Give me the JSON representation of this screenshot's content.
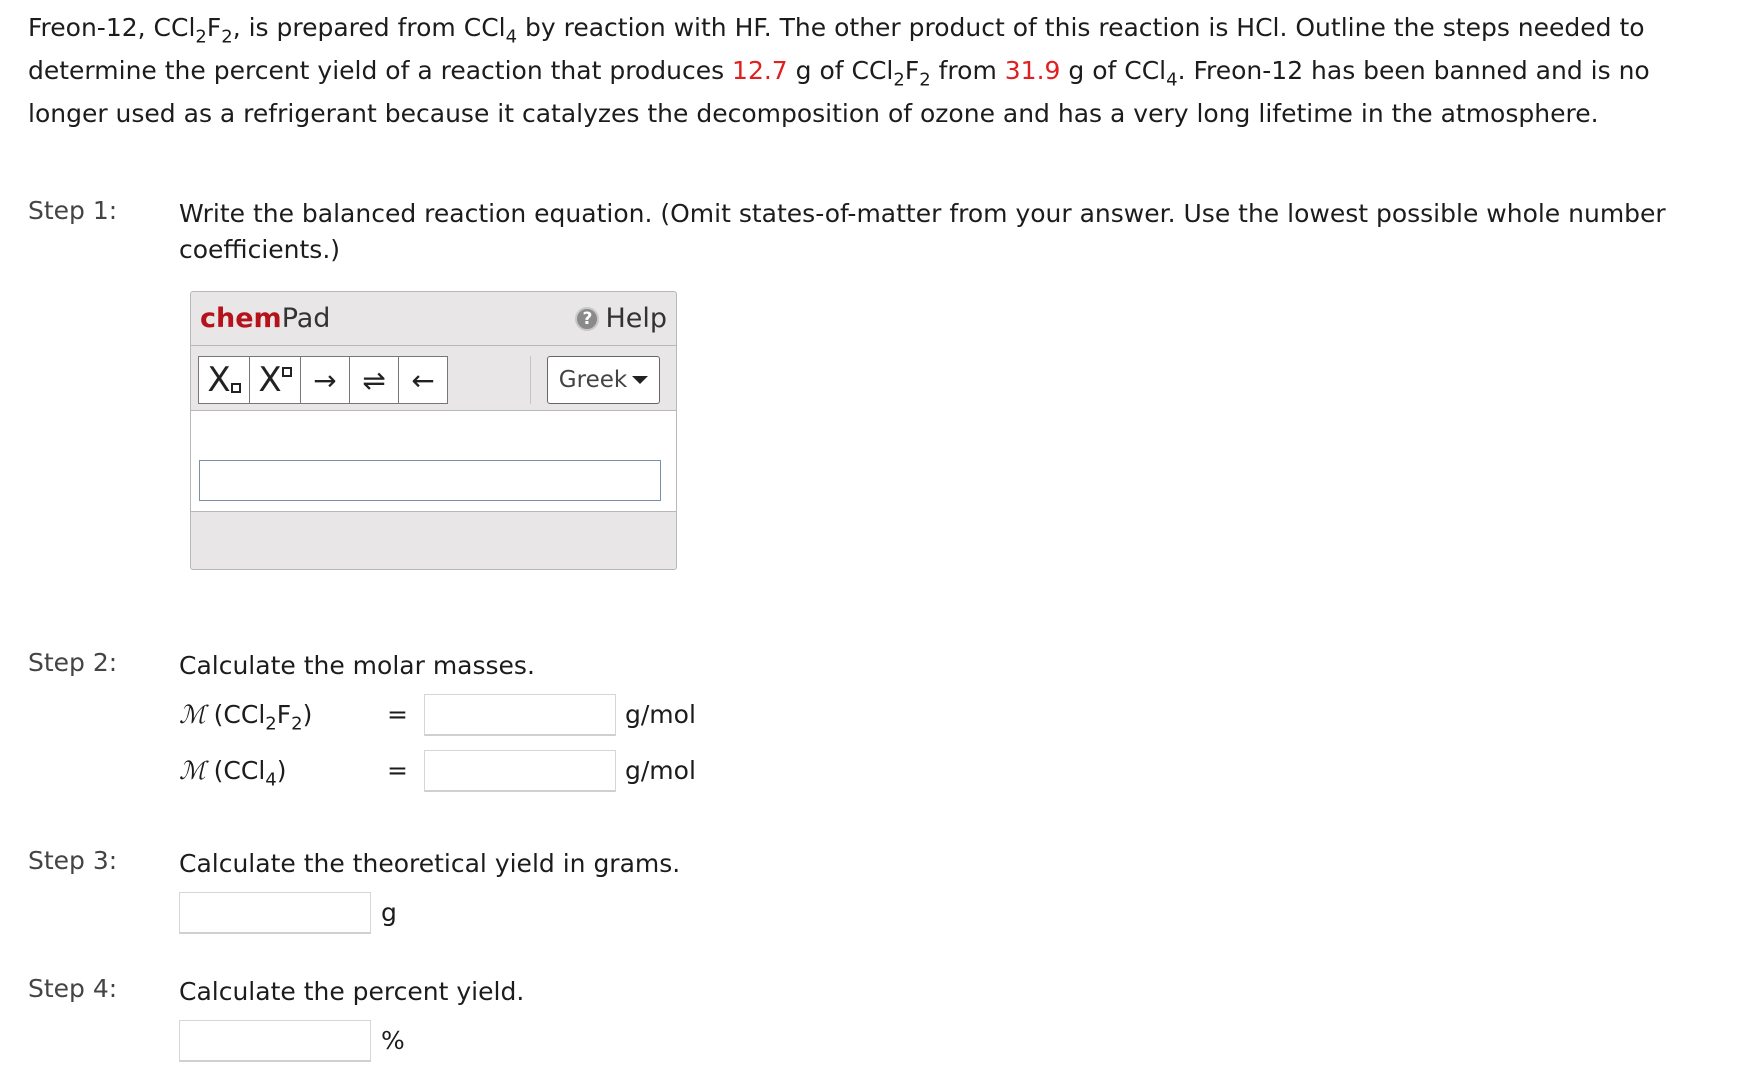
{
  "intro": {
    "p1": "Freon-12, CCl",
    "p1_sub1": "2",
    "p1_f": "F",
    "p1_sub2": "2",
    "p1_rest": ", is prepared from CCl",
    "p1_sub3": "4",
    "p1_rest2": " by reaction with HF. The other product of this reaction is HCl. Outline the steps needed to determine the percent yield of a reaction that produces ",
    "mass_product": "12.7",
    "p2": " g of CCl",
    "p2_sub1": "2",
    "p2_f": "F",
    "p2_sub2": "2",
    "p2_rest": " from ",
    "mass_reactant": "31.9",
    "p3": " g of CCl",
    "p3_sub": "4",
    "p3_rest": ". Freon-12 has been banned and is no longer used as a refrigerant because it catalyzes the decomposition of ozone and has a very long lifetime in the atmosphere."
  },
  "step1": {
    "label": "Step 1:",
    "text": "Write the balanced reaction equation. (Omit states-of-matter from your answer. Use the lowest possible whole number coefficients.)"
  },
  "chempad": {
    "title_chem": "chem",
    "title_pad": "Pad",
    "help_label": "Help",
    "help_icon_glyph": "?",
    "buttons": {
      "subscript": "X",
      "superscript": "X",
      "right_arrow": "→",
      "equilibrium_arrow": "⇌",
      "left_arrow": "←"
    },
    "greek_label": "Greek",
    "equation_value": ""
  },
  "step2": {
    "label": "Step 2:",
    "text": "Calculate the molar masses.",
    "rows": [
      {
        "symbol": "ℳ",
        "formula_a": " (CCl",
        "sub_a": "2",
        "formula_b": "F",
        "sub_b": "2",
        "formula_c": ")",
        "equals": "=",
        "value": "",
        "unit": "g/mol"
      },
      {
        "symbol": "ℳ",
        "formula_a": " (CCl",
        "sub_a": "4",
        "formula_c": ")",
        "equals": "=",
        "value": "",
        "unit": "g/mol"
      }
    ]
  },
  "step3": {
    "label": "Step 3:",
    "text": "Calculate the theoretical yield in grams.",
    "value": "",
    "unit": "g"
  },
  "step4": {
    "label": "Step 4:",
    "text": "Calculate the percent yield.",
    "value": "",
    "unit": "%"
  },
  "colors": {
    "highlight": "#e02020",
    "chem_brand": "#b5121b",
    "panel_bg": "#e8e6e6"
  }
}
